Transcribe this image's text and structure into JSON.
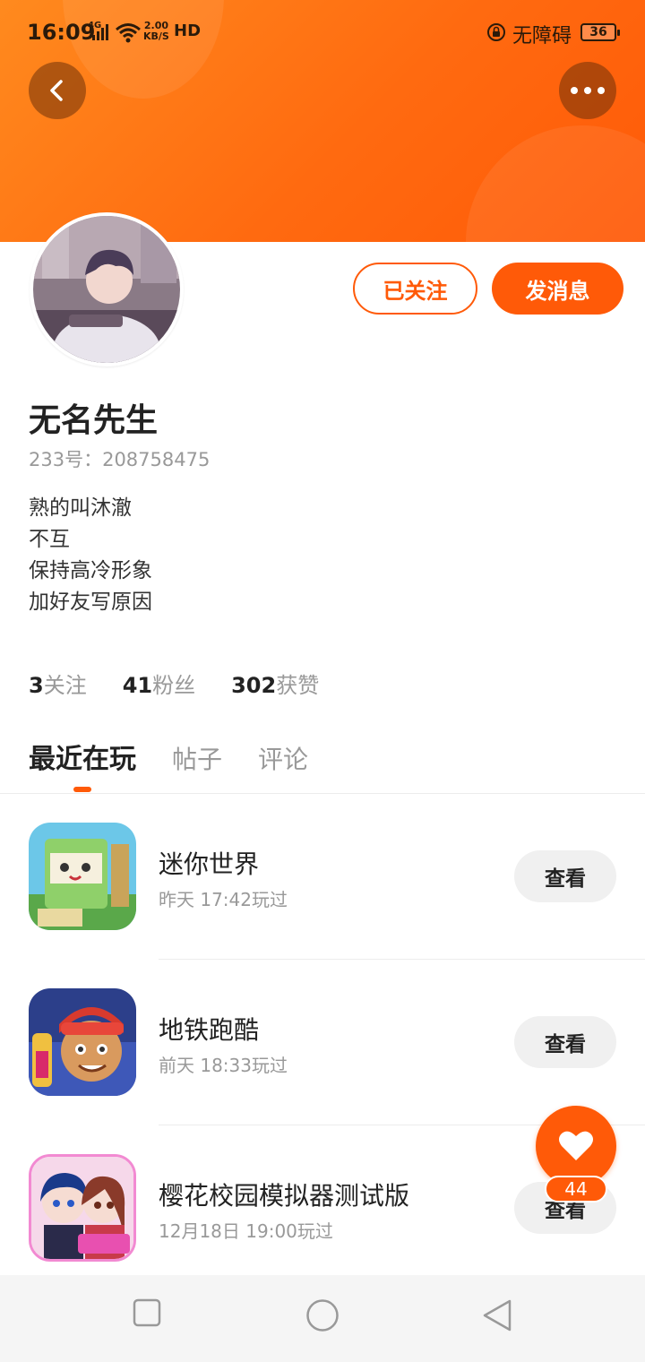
{
  "status_bar": {
    "time": "16:09",
    "network": "4G",
    "speed_value": "2.00",
    "speed_unit": "KB/S",
    "hd": "HD",
    "accessibility": "无障碍",
    "battery": "36"
  },
  "profile": {
    "username": "无名先生",
    "user_id": "233号：208758475",
    "bio": [
      "熟的叫沐澈",
      "不互",
      "保持高冷形象",
      "加好友写原因"
    ],
    "follow_label": "已关注",
    "message_label": "发消息"
  },
  "stats": [
    {
      "value": "3",
      "label": "关注"
    },
    {
      "value": "41",
      "label": "粉丝"
    },
    {
      "value": "302",
      "label": "获赞"
    }
  ],
  "tabs": [
    {
      "label": "最近在玩",
      "active": true
    },
    {
      "label": "帖子",
      "active": false
    },
    {
      "label": "评论",
      "active": false
    }
  ],
  "games": [
    {
      "name": "迷你世界",
      "time": "昨天 17:42玩过",
      "button": "查看"
    },
    {
      "name": "地铁跑酷",
      "time": "前天 18:33玩过",
      "button": "查看"
    },
    {
      "name": "樱花校园模拟器测试版",
      "time": "12月18日 19:00玩过",
      "button": "查看"
    }
  ],
  "like": {
    "count": "44"
  },
  "colors": {
    "accent": "#ff5a08",
    "banner": "#ff7a14"
  }
}
